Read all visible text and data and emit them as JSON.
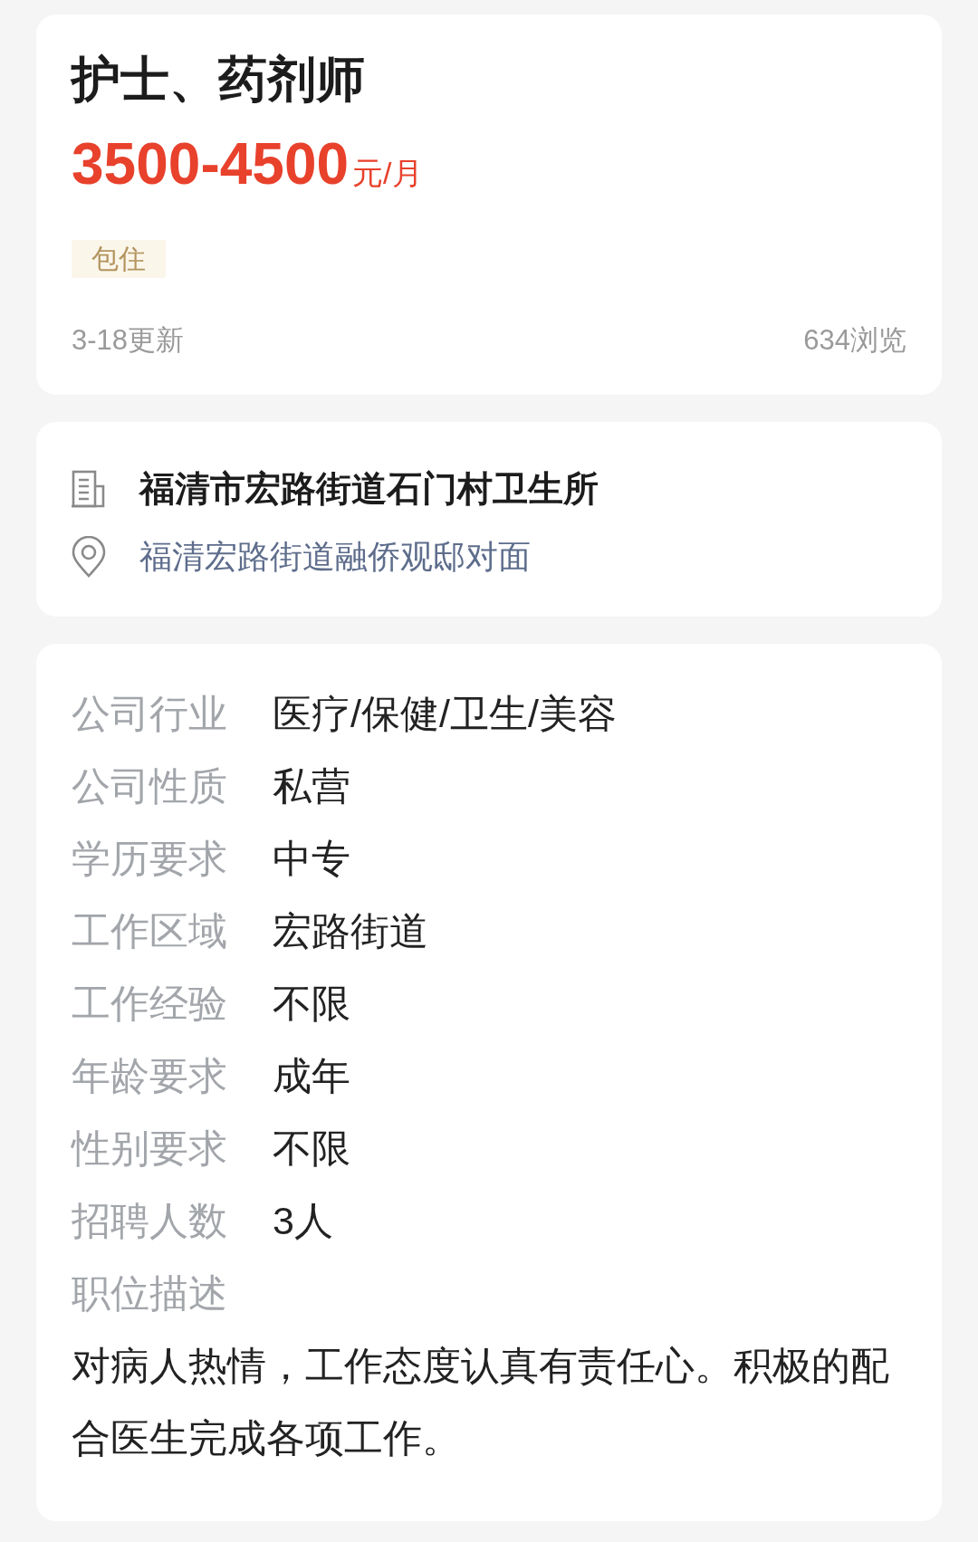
{
  "job": {
    "title": "护士、药剂师",
    "salary": {
      "range": "3500-4500",
      "unit": "元/月"
    },
    "tags": [
      "包住"
    ],
    "updated": "3-18更新",
    "views": "634浏览"
  },
  "company": {
    "name": "福清市宏路街道石门村卫生所",
    "address": "福清宏路街道融侨观邸对面"
  },
  "details": {
    "rows": [
      {
        "label": "公司行业",
        "value": "医疗/保健/卫生/美容"
      },
      {
        "label": "公司性质",
        "value": "私营"
      },
      {
        "label": "学历要求",
        "value": "中专"
      },
      {
        "label": "工作区域",
        "value": "宏路街道"
      },
      {
        "label": "工作经验",
        "value": "不限"
      },
      {
        "label": "年龄要求",
        "value": "成年"
      },
      {
        "label": "性别要求",
        "value": "不限"
      },
      {
        "label": "招聘人数",
        "value": "3人"
      }
    ],
    "description_label": "职位描述",
    "description": "对病人热情，工作态度认真有责任心。积极的配合医生完成各项工作。"
  }
}
